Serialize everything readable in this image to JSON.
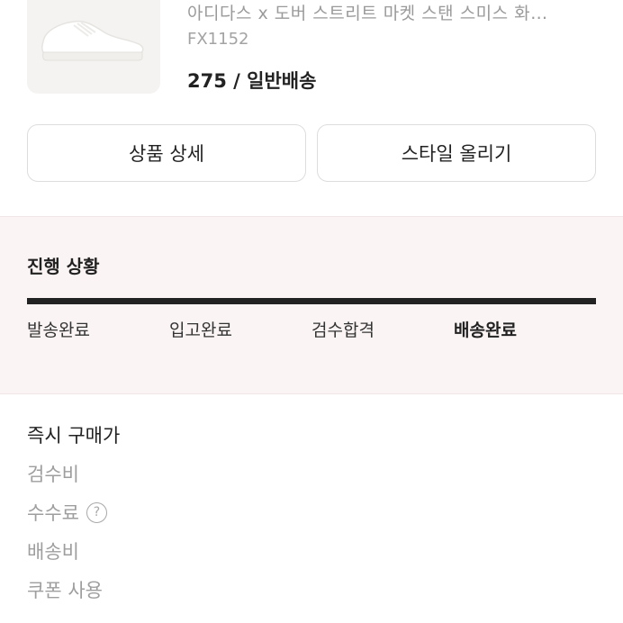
{
  "product": {
    "name": "아디다스 x 도버 스트리트 마켓 스탠 스미스 화…",
    "code": "FX1152",
    "size_shipping": "275 / 일반배송"
  },
  "actions": {
    "detail_label": "상품 상세",
    "style_label": "스타일 올리기"
  },
  "progress": {
    "title": "진행 상황",
    "steps": [
      "발송완료",
      "입고완료",
      "검수합격",
      "배송완료"
    ],
    "current_step": "배송완료",
    "bar_fill": 1.0
  },
  "price_list": {
    "rows": [
      "즉시 구매가",
      "검수비",
      "수수료",
      "배송비",
      "쿠폰 사용"
    ],
    "help_icon": "?"
  }
}
